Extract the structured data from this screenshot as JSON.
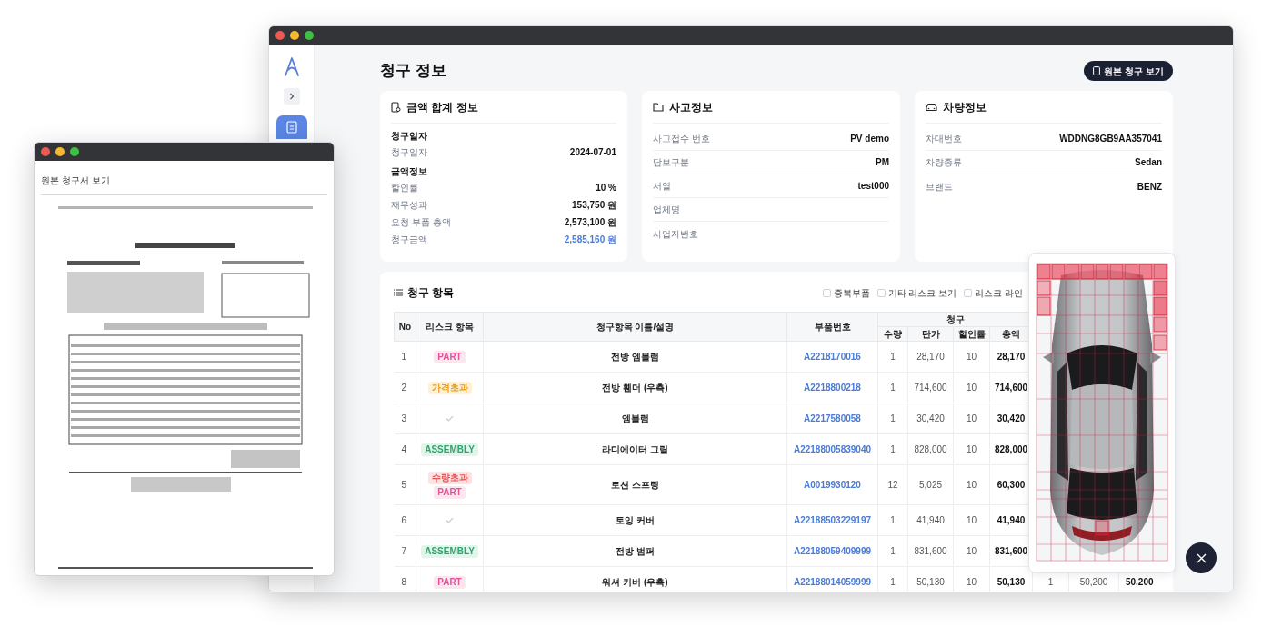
{
  "main_window": {
    "page_title": "청구 정보",
    "original_button": "원본 청구 보기",
    "amount_card": {
      "title": "금액 합계 정보",
      "sections": [
        {
          "heading": "청구일자",
          "rows": [
            {
              "label": "청구일자",
              "value": "2024-07-01",
              "highlight": false
            }
          ]
        },
        {
          "heading": "금액정보",
          "rows": [
            {
              "label": "할인률",
              "value": "10 %",
              "highlight": false
            },
            {
              "label": "재무성과",
              "value": "153,750 원",
              "highlight": false
            },
            {
              "label": "요청 부품 총액",
              "value": "2,573,100 원",
              "highlight": false
            },
            {
              "label": "청구금액",
              "value": "2,585,160 원",
              "highlight": true
            }
          ]
        }
      ]
    },
    "accident_card": {
      "title": "사고정보",
      "rows": [
        {
          "label": "사고접수 번호",
          "value": "PV demo"
        },
        {
          "label": "담보구분",
          "value": "PM"
        },
        {
          "label": "서열",
          "value": "test000"
        },
        {
          "label": "업체명"
        },
        {
          "label": "사업자번호"
        }
      ]
    },
    "vehicle_card": {
      "title": "차량정보",
      "rows": [
        {
          "label": "차대번호",
          "value": "WDDNG8GB9AA357041"
        },
        {
          "label": "차량종류",
          "value": "Sedan"
        },
        {
          "label": "브랜드",
          "value": "BENZ"
        }
      ]
    },
    "items_card": {
      "title": "청구 항목",
      "filters": [
        {
          "label": "중복부품",
          "checked": false
        },
        {
          "label": "기타 리스크 보기",
          "checked": false
        },
        {
          "label": "리스크 라인",
          "checked": false
        }
      ],
      "columns": [
        "No",
        "리스크 항목",
        "청구항목 이름/설명",
        "부품번호"
      ],
      "group_header": "청구",
      "sub_columns": [
        "수량",
        "단가",
        "할인률",
        "총액"
      ],
      "rows": [
        {
          "no": "1",
          "risks": [
            {
              "kind": "part",
              "label": "PART"
            }
          ],
          "name": "전방 엠블럼",
          "part_no": "A2218170016",
          "qty": "1",
          "price": "28,170",
          "discount": "10",
          "total": "28,170"
        },
        {
          "no": "2",
          "risks": [
            {
              "kind": "price",
              "label": "가격초과"
            }
          ],
          "name": "전방 휀더 (우측)",
          "part_no": "A2218800218",
          "qty": "1",
          "price": "714,600",
          "discount": "10",
          "total": "714,600"
        },
        {
          "no": "3",
          "risks": [
            {
              "kind": "ok"
            }
          ],
          "name": "엠블럼",
          "part_no": "A2217580058",
          "qty": "1",
          "price": "30,420",
          "discount": "10",
          "total": "30,420"
        },
        {
          "no": "4",
          "risks": [
            {
              "kind": "assembly",
              "label": "ASSEMBLY"
            }
          ],
          "name": "라디에이터 그릴",
          "part_no": "A22188005839040",
          "qty": "1",
          "price": "828,000",
          "discount": "10",
          "total": "828,000"
        },
        {
          "no": "5",
          "risks": [
            {
              "kind": "quantity",
              "label": "수량초과"
            },
            {
              "kind": "part",
              "label": "PART"
            }
          ],
          "name": "토션 스프링",
          "part_no": "A0019930120",
          "qty": "12",
          "price": "5,025",
          "discount": "10",
          "total": "60,300"
        },
        {
          "no": "6",
          "risks": [
            {
              "kind": "ok"
            }
          ],
          "name": "토잉 커버",
          "part_no": "A22188503229197",
          "qty": "1",
          "price": "41,940",
          "discount": "10",
          "total": "41,940"
        },
        {
          "no": "7",
          "risks": [
            {
              "kind": "assembly",
              "label": "ASSEMBLY"
            }
          ],
          "name": "전방 범퍼",
          "part_no": "A22188059409999",
          "qty": "1",
          "price": "831,600",
          "discount": "10",
          "total": "831,600"
        },
        {
          "no": "8",
          "risks": [
            {
              "kind": "part",
              "label": "PART"
            }
          ],
          "name": "워셔 커버 (우측)",
          "part_no": "A22188014059999",
          "qty": "1",
          "price": "50,130",
          "discount": "10",
          "total": "50,130",
          "column_9": "1",
          "column_10": "50,200",
          "column_11": "50,200"
        }
      ]
    }
  },
  "document_window": {
    "title": "원본 청구서 보기",
    "kind": "picture"
  }
}
